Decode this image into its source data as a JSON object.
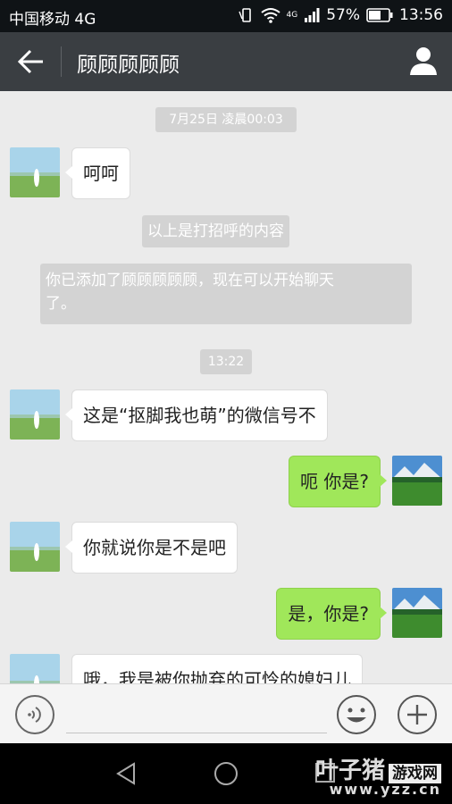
{
  "status": {
    "carrier": "中国移动 4G",
    "network_badge": "4G",
    "battery": "57%",
    "time": "13:56"
  },
  "header": {
    "title": "顾顾顾顾顾"
  },
  "chat": {
    "time1": "7月25日 凌晨00:03",
    "msg1": "呵呵",
    "sys1": "以上是打招呼的内容",
    "sys2_line1": "你已添加了顾顾顾顾顾，现在可以开始聊天",
    "sys2_line2": "了。",
    "time2": "13:22",
    "msg2": "这是“抠脚我也萌”的微信号不",
    "msg3": "呃 你是?",
    "msg4": "你就说你是不是吧",
    "msg5": "是，你是?",
    "msg6": "哦，我是被你抛弃的可怜的媳妇儿"
  },
  "watermark": {
    "brand": "叶子猪",
    "tag": "游戏网",
    "url": "www.yzz.cn"
  }
}
